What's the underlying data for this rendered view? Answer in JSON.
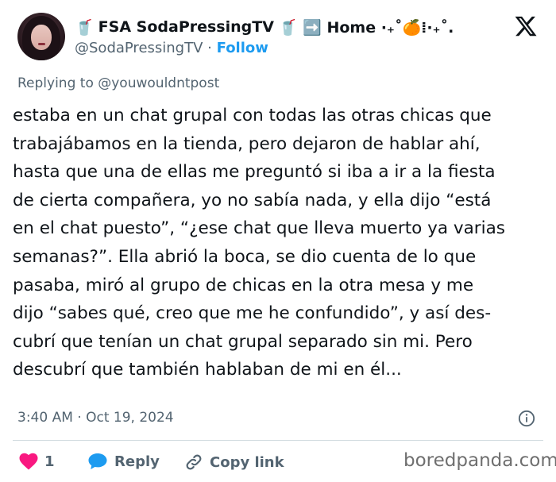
{
  "author": {
    "display_name_prefix_emoji": "🥤",
    "display_name": "FSA SodaPressingTV",
    "display_name_suffix": "🥤 ➡️ Home ·₊˚🍊⁞·₊˚.",
    "handle": "@SodaPressingTV",
    "separator": "·",
    "follow_label": "Follow"
  },
  "replying_to": {
    "prefix": "Replying to",
    "mention": "@youwouldntpost"
  },
  "tweet": {
    "lines": [
      "estaba en un chat grupal con todas las otras chicas que",
      "trabajábamos en la tienda, pero dejaron de hablar ahí,",
      "hasta que una de ellas me preguntó si iba a ir a la fiesta",
      "de cierta compañera, yo no sabía nada, y ella dijo “está",
      "en el chat puesto”, “¿ese chat que lleva muerto ya varias",
      "semanas?”. Ella abrió la boca, se dio cuenta de lo que",
      "pasaba, miró al grupo de chicas en la otra mesa y me",
      "dijo “sabes qué, creo que me he confundido”, y así des-",
      "cubrí que tenían un chat grupal separado sin mi. Pero",
      "descubrí que también hablaban de mi en él..."
    ]
  },
  "meta": {
    "time": "3:40 AM",
    "separator": "·",
    "date": "Oct 19, 2024"
  },
  "actions": {
    "like_count": "1",
    "reply_label": "Reply",
    "copy_link_label": "Copy link"
  },
  "watermark": "boredpanda.com",
  "colors": {
    "text": "#0f1419",
    "secondary": "#536471",
    "follow": "#1d9bf0",
    "like": "#f91880",
    "reply": "#1d9bf0",
    "divider": "#cfd9de"
  },
  "icons": [
    "cup-emoji",
    "x-logo",
    "info-icon",
    "heart-icon",
    "speech-bubble-icon",
    "link-icon"
  ]
}
